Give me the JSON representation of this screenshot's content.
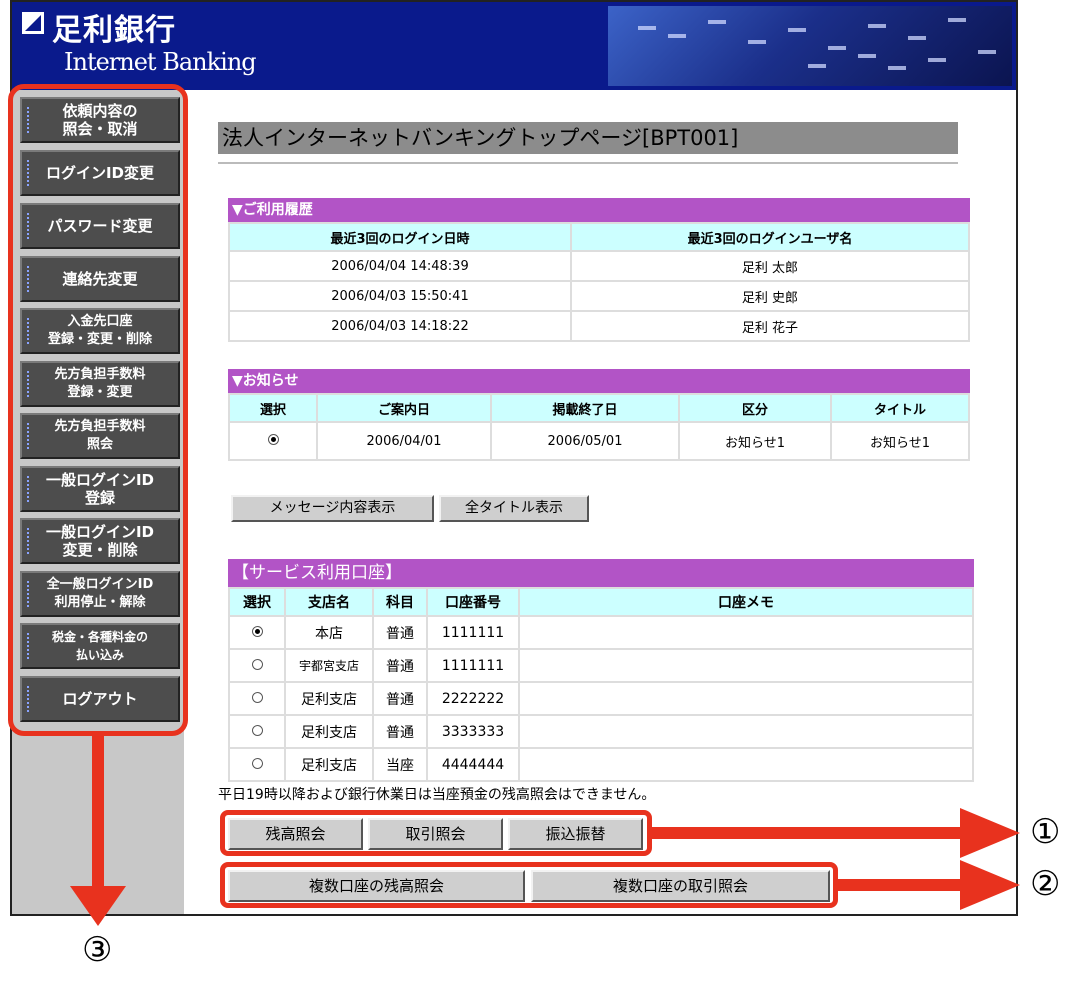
{
  "header": {
    "bank_name": "足利銀行",
    "subtitle": "Internet Banking"
  },
  "sidebar": {
    "items": [
      {
        "label": "依頼内容の\n照会・取消"
      },
      {
        "label": "ログインID変更"
      },
      {
        "label": "パスワード変更"
      },
      {
        "label": "連絡先変更"
      },
      {
        "label": "入金先口座\n登録・変更・削除"
      },
      {
        "label": "先方負担手数料\n登録・変更"
      },
      {
        "label": "先方負担手数料\n照会"
      },
      {
        "label": "一般ログインID\n登録"
      },
      {
        "label": "一般ログインID\n変更・削除"
      },
      {
        "label": "全一般ログインID\n利用停止・解除"
      },
      {
        "label": "税金・各種料金の\n払い込み"
      },
      {
        "label": "ログアウト"
      }
    ]
  },
  "page_title": "法人インターネットバンキングトップページ[BPT001]",
  "history": {
    "heading": "▼ご利用履歴",
    "columns": [
      "最近3回のログイン日時",
      "最近3回のログインユーザ名"
    ],
    "rows": [
      [
        "2006/04/04 14:48:39",
        "足利 太郎"
      ],
      [
        "2006/04/03 15:50:41",
        "足利 史郎"
      ],
      [
        "2006/04/03 14:18:22",
        "足利 花子"
      ]
    ]
  },
  "notices": {
    "heading": "▼お知らせ",
    "columns": [
      "選択",
      "ご案内日",
      "掲載終了日",
      "区分",
      "タイトル"
    ],
    "rows": [
      [
        "",
        "2006/04/01",
        "2006/05/01",
        "お知らせ1",
        "お知らせ1"
      ]
    ],
    "buttons": {
      "show_message": "メッセージ内容表示",
      "show_all_titles": "全タイトル表示"
    }
  },
  "accounts": {
    "heading": "【サービス利用口座】",
    "columns": [
      "選択",
      "支店名",
      "科目",
      "口座番号",
      "口座メモ"
    ],
    "rows": [
      {
        "selected": true,
        "branch": "本店",
        "type": "普通",
        "number": "1111111",
        "memo": ""
      },
      {
        "selected": false,
        "branch": "宇都宮支店",
        "type": "普通",
        "number": "1111111",
        "memo": ""
      },
      {
        "selected": false,
        "branch": "足利支店",
        "type": "普通",
        "number": "2222222",
        "memo": ""
      },
      {
        "selected": false,
        "branch": "足利支店",
        "type": "普通",
        "number": "3333333",
        "memo": ""
      },
      {
        "selected": false,
        "branch": "足利支店",
        "type": "当座",
        "number": "4444444",
        "memo": ""
      }
    ],
    "note": "平日19時以降および銀行休業日は当座預金の残高照会はできません。"
  },
  "actions": {
    "balance": "残高照会",
    "transactions": "取引照会",
    "transfer": "振込振替",
    "multi_balance": "複数口座の残高照会",
    "multi_transactions": "複数口座の取引照会"
  },
  "annotations": {
    "label1": "①",
    "label2": "②",
    "label3": "③"
  },
  "colors": {
    "accent_red": "#e8321e",
    "header_blue": "#0a1a8c",
    "section_purple": "#b254c6",
    "table_header": "#ccffff"
  }
}
